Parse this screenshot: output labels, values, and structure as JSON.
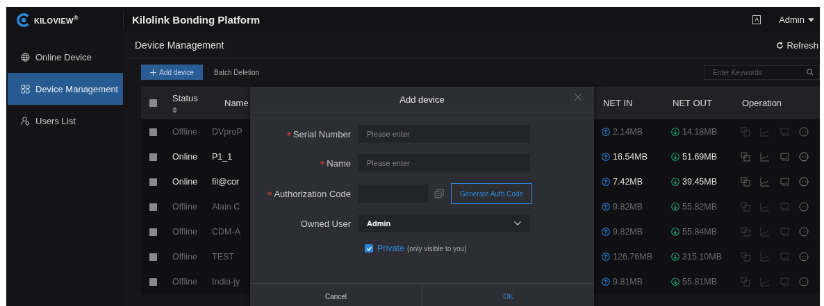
{
  "brand": {
    "logo_text": "KILOVIEW$^{®}$"
  },
  "header": {
    "title": "Kilolink Bonding Platform",
    "lang_icon": "A",
    "user": "Admin"
  },
  "sidebar": {
    "items": [
      {
        "label": "Online Device",
        "selected": false
      },
      {
        "label": "Device Management",
        "selected": true
      },
      {
        "label": "Users List",
        "selected": false
      }
    ]
  },
  "page": {
    "title": "Device Management",
    "refresh": "Refresh"
  },
  "toolbar": {
    "add": "Add device",
    "batch": "Batch Deletion",
    "search": {
      "placeholder": "Enter Keywords"
    }
  },
  "table": {
    "all_checked": false,
    "columns": [
      "Status",
      "Name",
      "NET IN",
      "NET OUT",
      "Operation"
    ],
    "rows": [
      {
        "checked": false,
        "online": false,
        "status": "Offline",
        "name": "DVproP",
        "net_in": "2.14MB",
        "net_out": "14.18MB"
      },
      {
        "checked": false,
        "online": true,
        "status": "Online",
        "name": "P1_1",
        "net_in": "16.54MB",
        "net_out": "51.69MB"
      },
      {
        "checked": false,
        "online": true,
        "status": "Online",
        "name": "fil@cor",
        "net_in": "7.42MB",
        "net_out": "39.45MB"
      },
      {
        "checked": false,
        "online": false,
        "status": "Offline",
        "name": "Alain C",
        "net_in": "9.82MB",
        "net_out": "55.82MB"
      },
      {
        "checked": false,
        "online": false,
        "status": "Offline",
        "name": "CDM-A",
        "net_in": "9.82MB",
        "net_out": "55.84MB"
      },
      {
        "checked": false,
        "online": false,
        "status": "Offline",
        "name": "TEST",
        "net_in": "126.76MB",
        "net_out": "315.10MB"
      },
      {
        "checked": false,
        "online": false,
        "status": "Offline",
        "name": "India-jy",
        "net_in": "9.81MB",
        "net_out": "55.81MB"
      }
    ]
  },
  "dialog": {
    "title": "Add device",
    "fields": [
      {
        "kind": "text",
        "label": "Serial Number",
        "required": true,
        "placeholder": "Please enter"
      },
      {
        "kind": "text",
        "label": "Name",
        "required": true,
        "placeholder": "Please enter"
      },
      {
        "kind": "code",
        "label": "Authorization Code",
        "required": true,
        "button": "Generate Auth Code"
      },
      {
        "kind": "select",
        "label": "Owned User",
        "required": false,
        "value": "Admin"
      }
    ],
    "private": {
      "checked": true,
      "label": "Private",
      "hint": "(only visible to you)"
    },
    "buttons": [
      {
        "kind": "cancel",
        "label": "Cancel"
      },
      {
        "kind": "ok",
        "label": "OK"
      }
    ]
  }
}
